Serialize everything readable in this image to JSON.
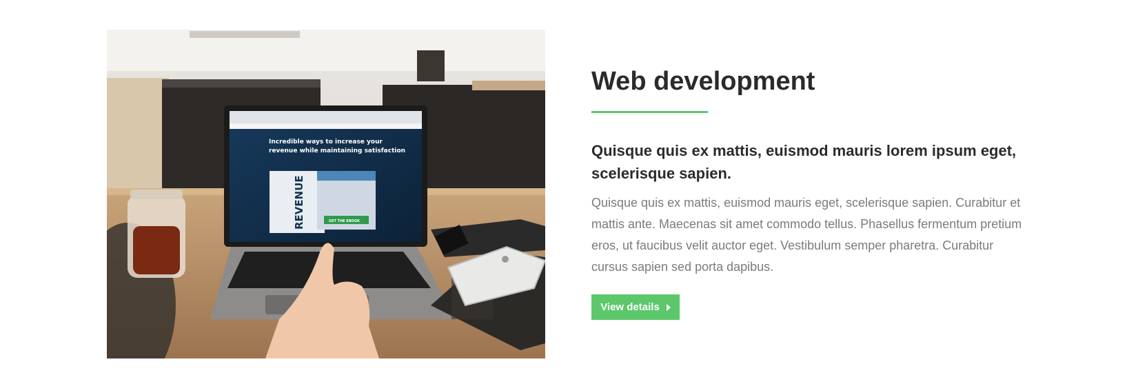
{
  "feature": {
    "title": "Web development",
    "subtitle": "Quisque quis ex mattis, euismod mauris lorem ipsum eget, scelerisque sapien.",
    "description": "Quisque quis ex mattis, euismod mauris eget, scelerisque sapien. Curabitur et mattis ante. Maecenas sit amet commodo tellus. Phasellus fermentum pretium eros, ut faucibus velit auctor eget. Vestibulum semper pharetra. Curabitur cursus sapien sed porta dapibus.",
    "button_label": "View details",
    "button_icon": "chevron-right-icon",
    "accent_color": "#5cc86b"
  },
  "photo": {
    "screen_headline_1": "Incredible ways to increase your",
    "screen_headline_2": "revenue while maintaining satisfaction",
    "screen_banner": "REVENUE",
    "screen_cta": "GET THE EBOOK"
  }
}
